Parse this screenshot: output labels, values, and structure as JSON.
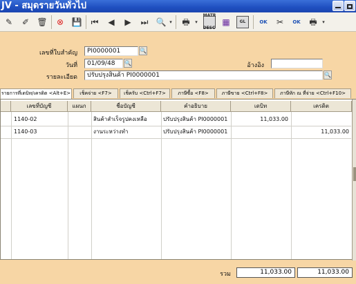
{
  "window": {
    "title": "JV - สมุดรายวันทั่วไป"
  },
  "toolbar": {
    "icons": [
      "edit-icon",
      "edit2-icon",
      "trash-icon",
      "cancel-icon",
      "save-icon",
      "first-icon",
      "prev-icon",
      "next-icon",
      "last-icon",
      "search-icon",
      "print-icon",
      "print-dropdown-icon",
      "matrix-desc-icon",
      "report-icon",
      "gl-icon",
      "ok-icon",
      "printer2-icon",
      "ok2-icon",
      "printer3-icon",
      "dropdown-icon"
    ],
    "box1": "MATR DESC",
    "box2": "GL",
    "ok1": "OK",
    "ok2": "OK"
  },
  "form": {
    "doc_no_label": "เลขที่ใบสำคัญ",
    "doc_no": "PI0000001",
    "date_label": "วันที่",
    "date": "01/09/48",
    "ref_label": "อ้างอิง",
    "ref": "",
    "desc_label": "รายละเอียด",
    "desc": "ปรับปรุงสินค้า PI0000001"
  },
  "tabs": [
    "รายการที่เดบิท/เครดิต <Alt+E>",
    "เช็คจ่าย <F7>",
    "เช็ครับ <Ctrl+F7>",
    "ภาษีซื้อ <F8>",
    "ภาษีขาย <Ctrl+F8>",
    "ภาษีหัก ณ ที่จ่าย <Ctrl+F10>"
  ],
  "grid": {
    "headers": [
      "เลขที่บัญชี",
      "แผนก",
      "ชื่อบัญชี",
      "คำอธิบาย",
      "เดบิท",
      "เครดิต"
    ],
    "rows": [
      [
        "1140-02",
        "",
        "สินค้าสำเร็จรูปคงเหลือ",
        "ปรับปรุงสินค้า PI0000001",
        "11,033.00",
        ""
      ],
      [
        "1140-03",
        "",
        "งานระหว่างทำ",
        "ปรับปรุงสินค้า PI0000001",
        "",
        "11,033.00"
      ]
    ]
  },
  "footer": {
    "total_label": "รวม",
    "total_debit": "11,033.00",
    "total_credit": "11,033.00"
  }
}
